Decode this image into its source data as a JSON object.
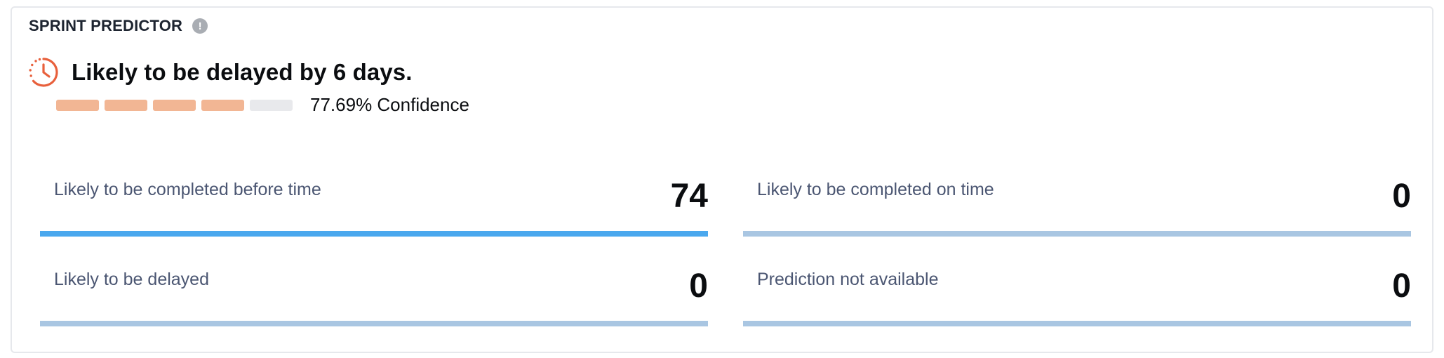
{
  "header": {
    "title": "SPRINT PREDICTOR",
    "info_icon": "!"
  },
  "prediction": {
    "icon": "clock-delay-icon",
    "text": "Likely to be delayed by 6 days.",
    "confidence_text": "77.69% Confidence",
    "confidence_segments_filled": 4,
    "confidence_segments_total": 5
  },
  "stats": [
    {
      "label": "Likely to be completed before time",
      "value": "74",
      "fill_fraction": 1.0
    },
    {
      "label": "Likely to be completed on time",
      "value": "0",
      "fill_fraction": 0.0
    },
    {
      "label": "Likely to be delayed",
      "value": "0",
      "fill_fraction": 0.0
    },
    {
      "label": "Prediction not available",
      "value": "0",
      "fill_fraction": 0.0
    }
  ],
  "colors": {
    "delay_accent": "#e8603c",
    "confidence_filled": "#f2b694",
    "confidence_empty": "#e8e9ec",
    "bar_active": "#4aa8ee",
    "bar_track": "#a9c6e2"
  }
}
